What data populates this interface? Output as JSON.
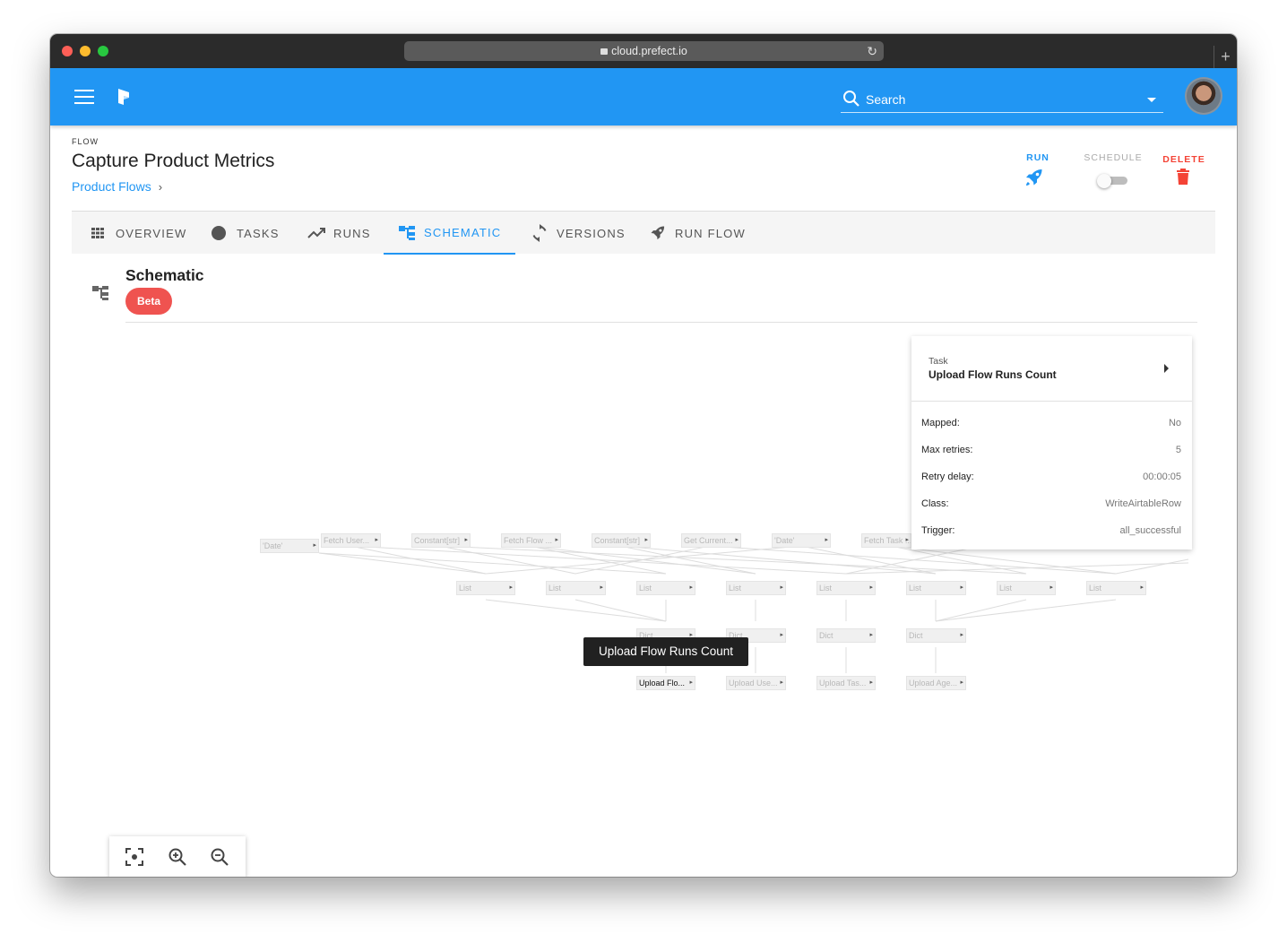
{
  "browser": {
    "url": "cloud.prefect.io"
  },
  "appbar": {
    "search_placeholder": "Search"
  },
  "flow": {
    "label": "FLOW",
    "title": "Capture Product Metrics",
    "breadcrumb": "Product Flows"
  },
  "actions": {
    "run": "RUN",
    "schedule": "SCHEDULE",
    "delete": "DELETE"
  },
  "tabs": [
    {
      "label": "OVERVIEW",
      "icon": "grid-icon"
    },
    {
      "label": "TASKS",
      "icon": "circle-icon"
    },
    {
      "label": "RUNS",
      "icon": "trending-up-icon"
    },
    {
      "label": "SCHEMATIC",
      "icon": "schematic-icon",
      "active": true
    },
    {
      "label": "VERSIONS",
      "icon": "sync-icon"
    },
    {
      "label": "RUN FLOW",
      "icon": "rocket-icon"
    }
  ],
  "schematic": {
    "title": "Schematic",
    "badge": "Beta"
  },
  "graph": {
    "row1": [
      "'Date'",
      "Fetch User...",
      "Constant[str]",
      "Fetch Flow ...",
      "Constant[str]",
      "Get Current...",
      "'Date'",
      "Fetch Task ..."
    ],
    "row2": [
      "List",
      "List",
      "List",
      "List",
      "List",
      "List",
      "List",
      "List"
    ],
    "row3": [
      "Dict",
      "Dict",
      "Dict",
      "Dict"
    ],
    "row4": [
      "Upload Flo...",
      "Upload Use...",
      "Upload Tas...",
      "Upload Age..."
    ]
  },
  "tooltip": "Upload Flow Runs Count",
  "task_panel": {
    "subtitle": "Task",
    "name": "Upload Flow Runs Count",
    "rows": [
      {
        "key": "Mapped:",
        "value": "No"
      },
      {
        "key": "Max retries:",
        "value": "5"
      },
      {
        "key": "Retry delay:",
        "value": "00:00:05"
      },
      {
        "key": "Class:",
        "value": "WriteAirtableRow"
      },
      {
        "key": "Trigger:",
        "value": "all_successful"
      }
    ]
  },
  "colors": {
    "primary": "#2196f3",
    "danger": "#f44336",
    "badge": "#ef5350"
  }
}
